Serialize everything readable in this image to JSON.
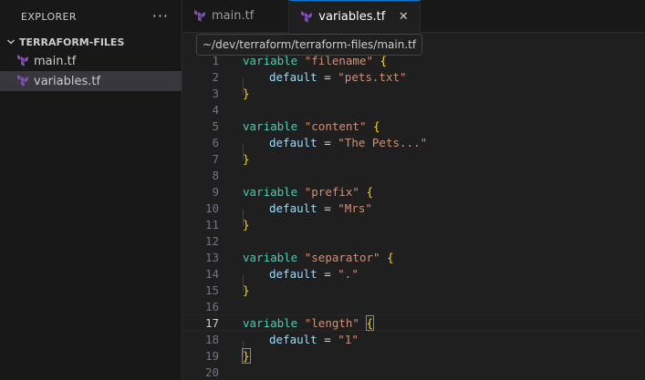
{
  "sidebar": {
    "title": "EXPLORER",
    "more": "···",
    "folder": "TERRAFORM-FILES",
    "files": [
      {
        "name": "main.tf",
        "active": false
      },
      {
        "name": "variables.tf",
        "active": true
      }
    ]
  },
  "tabs": [
    {
      "label": "main.tf",
      "active": false
    },
    {
      "label": "variables.tf",
      "active": true,
      "close": "✕"
    }
  ],
  "tooltip": "~/dev/terraform/terraform-files/main.tf",
  "editor": {
    "current_line": 17,
    "lines": [
      {
        "n": "1",
        "kw": "variable",
        "name": "\"filename\"",
        "brace": "{"
      },
      {
        "n": "2",
        "prop": "default",
        "eq": "=",
        "val": "\"pets.txt\""
      },
      {
        "n": "3",
        "close": "}"
      },
      {
        "n": "4"
      },
      {
        "n": "5",
        "kw": "variable",
        "name": "\"content\"",
        "brace": "{"
      },
      {
        "n": "6",
        "prop": "default",
        "eq": "=",
        "val": "\"The Pets...\""
      },
      {
        "n": "7",
        "close": "}"
      },
      {
        "n": "8"
      },
      {
        "n": "9",
        "kw": "variable",
        "name": "\"prefix\"",
        "brace": "{"
      },
      {
        "n": "10",
        "prop": "default",
        "eq": "=",
        "val": "\"Mrs\""
      },
      {
        "n": "11",
        "close": "}"
      },
      {
        "n": "12"
      },
      {
        "n": "13",
        "kw": "variable",
        "name": "\"separator\"",
        "brace": "{"
      },
      {
        "n": "14",
        "prop": "default",
        "eq": "=",
        "val": "\".\""
      },
      {
        "n": "15",
        "close": "}"
      },
      {
        "n": "16"
      },
      {
        "n": "17",
        "kw": "variable",
        "name": "\"length\"",
        "brace": "{"
      },
      {
        "n": "18",
        "prop": "default",
        "eq": "=",
        "val": "\"1\""
      },
      {
        "n": "19",
        "close": "}"
      },
      {
        "n": "20"
      }
    ]
  }
}
